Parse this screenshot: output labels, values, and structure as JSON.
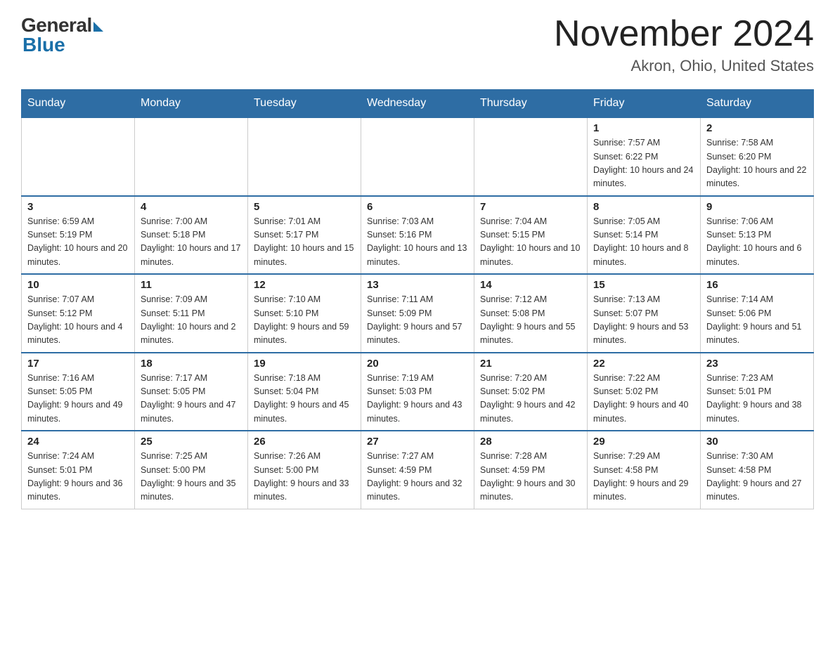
{
  "logo": {
    "general": "General",
    "blue": "Blue"
  },
  "title": {
    "month_year": "November 2024",
    "location": "Akron, Ohio, United States"
  },
  "days_header": [
    "Sunday",
    "Monday",
    "Tuesday",
    "Wednesday",
    "Thursday",
    "Friday",
    "Saturday"
  ],
  "weeks": [
    [
      {
        "day": "",
        "info": ""
      },
      {
        "day": "",
        "info": ""
      },
      {
        "day": "",
        "info": ""
      },
      {
        "day": "",
        "info": ""
      },
      {
        "day": "",
        "info": ""
      },
      {
        "day": "1",
        "info": "Sunrise: 7:57 AM\nSunset: 6:22 PM\nDaylight: 10 hours and 24 minutes."
      },
      {
        "day": "2",
        "info": "Sunrise: 7:58 AM\nSunset: 6:20 PM\nDaylight: 10 hours and 22 minutes."
      }
    ],
    [
      {
        "day": "3",
        "info": "Sunrise: 6:59 AM\nSunset: 5:19 PM\nDaylight: 10 hours and 20 minutes."
      },
      {
        "day": "4",
        "info": "Sunrise: 7:00 AM\nSunset: 5:18 PM\nDaylight: 10 hours and 17 minutes."
      },
      {
        "day": "5",
        "info": "Sunrise: 7:01 AM\nSunset: 5:17 PM\nDaylight: 10 hours and 15 minutes."
      },
      {
        "day": "6",
        "info": "Sunrise: 7:03 AM\nSunset: 5:16 PM\nDaylight: 10 hours and 13 minutes."
      },
      {
        "day": "7",
        "info": "Sunrise: 7:04 AM\nSunset: 5:15 PM\nDaylight: 10 hours and 10 minutes."
      },
      {
        "day": "8",
        "info": "Sunrise: 7:05 AM\nSunset: 5:14 PM\nDaylight: 10 hours and 8 minutes."
      },
      {
        "day": "9",
        "info": "Sunrise: 7:06 AM\nSunset: 5:13 PM\nDaylight: 10 hours and 6 minutes."
      }
    ],
    [
      {
        "day": "10",
        "info": "Sunrise: 7:07 AM\nSunset: 5:12 PM\nDaylight: 10 hours and 4 minutes."
      },
      {
        "day": "11",
        "info": "Sunrise: 7:09 AM\nSunset: 5:11 PM\nDaylight: 10 hours and 2 minutes."
      },
      {
        "day": "12",
        "info": "Sunrise: 7:10 AM\nSunset: 5:10 PM\nDaylight: 9 hours and 59 minutes."
      },
      {
        "day": "13",
        "info": "Sunrise: 7:11 AM\nSunset: 5:09 PM\nDaylight: 9 hours and 57 minutes."
      },
      {
        "day": "14",
        "info": "Sunrise: 7:12 AM\nSunset: 5:08 PM\nDaylight: 9 hours and 55 minutes."
      },
      {
        "day": "15",
        "info": "Sunrise: 7:13 AM\nSunset: 5:07 PM\nDaylight: 9 hours and 53 minutes."
      },
      {
        "day": "16",
        "info": "Sunrise: 7:14 AM\nSunset: 5:06 PM\nDaylight: 9 hours and 51 minutes."
      }
    ],
    [
      {
        "day": "17",
        "info": "Sunrise: 7:16 AM\nSunset: 5:05 PM\nDaylight: 9 hours and 49 minutes."
      },
      {
        "day": "18",
        "info": "Sunrise: 7:17 AM\nSunset: 5:05 PM\nDaylight: 9 hours and 47 minutes."
      },
      {
        "day": "19",
        "info": "Sunrise: 7:18 AM\nSunset: 5:04 PM\nDaylight: 9 hours and 45 minutes."
      },
      {
        "day": "20",
        "info": "Sunrise: 7:19 AM\nSunset: 5:03 PM\nDaylight: 9 hours and 43 minutes."
      },
      {
        "day": "21",
        "info": "Sunrise: 7:20 AM\nSunset: 5:02 PM\nDaylight: 9 hours and 42 minutes."
      },
      {
        "day": "22",
        "info": "Sunrise: 7:22 AM\nSunset: 5:02 PM\nDaylight: 9 hours and 40 minutes."
      },
      {
        "day": "23",
        "info": "Sunrise: 7:23 AM\nSunset: 5:01 PM\nDaylight: 9 hours and 38 minutes."
      }
    ],
    [
      {
        "day": "24",
        "info": "Sunrise: 7:24 AM\nSunset: 5:01 PM\nDaylight: 9 hours and 36 minutes."
      },
      {
        "day": "25",
        "info": "Sunrise: 7:25 AM\nSunset: 5:00 PM\nDaylight: 9 hours and 35 minutes."
      },
      {
        "day": "26",
        "info": "Sunrise: 7:26 AM\nSunset: 5:00 PM\nDaylight: 9 hours and 33 minutes."
      },
      {
        "day": "27",
        "info": "Sunrise: 7:27 AM\nSunset: 4:59 PM\nDaylight: 9 hours and 32 minutes."
      },
      {
        "day": "28",
        "info": "Sunrise: 7:28 AM\nSunset: 4:59 PM\nDaylight: 9 hours and 30 minutes."
      },
      {
        "day": "29",
        "info": "Sunrise: 7:29 AM\nSunset: 4:58 PM\nDaylight: 9 hours and 29 minutes."
      },
      {
        "day": "30",
        "info": "Sunrise: 7:30 AM\nSunset: 4:58 PM\nDaylight: 9 hours and 27 minutes."
      }
    ]
  ]
}
